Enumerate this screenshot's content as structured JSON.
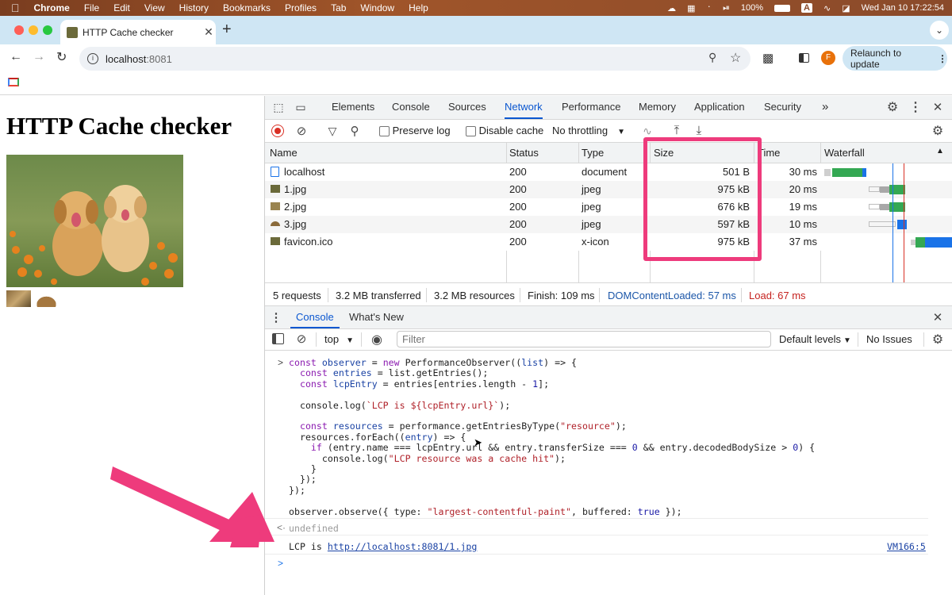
{
  "menubar": {
    "apple": "",
    "items": [
      "Chrome",
      "File",
      "Edit",
      "View",
      "History",
      "Bookmarks",
      "Profiles",
      "Tab",
      "Window",
      "Help"
    ],
    "battery": "100%",
    "input_source": "A",
    "datetime": "Wed Jan 10  17:22:54"
  },
  "browser": {
    "tab_title": "HTTP Cache checker",
    "new_tab": "+",
    "url_host": "localhost",
    "url_port": ":8081",
    "relaunch_label": "Relaunch to update",
    "profile_initial": "F"
  },
  "page": {
    "heading": "HTTP Cache checker"
  },
  "devtools": {
    "tabs": [
      "Elements",
      "Console",
      "Sources",
      "Network",
      "Performance",
      "Memory",
      "Application",
      "Security"
    ],
    "active_tab": "Network",
    "network_toolbar": {
      "preserve_log": "Preserve log",
      "disable_cache": "Disable cache",
      "throttling": "No throttling"
    },
    "columns": [
      "Name",
      "Status",
      "Type",
      "Size",
      "Time",
      "Waterfall"
    ],
    "rows": [
      {
        "name": "localhost",
        "status": "200",
        "type": "document",
        "size": "501 B",
        "time": "30 ms"
      },
      {
        "name": "1.jpg",
        "status": "200",
        "type": "jpeg",
        "size": "975 kB",
        "time": "20 ms"
      },
      {
        "name": "2.jpg",
        "status": "200",
        "type": "jpeg",
        "size": "676 kB",
        "time": "19 ms"
      },
      {
        "name": "3.jpg",
        "status": "200",
        "type": "jpeg",
        "size": "597 kB",
        "time": "10 ms"
      },
      {
        "name": "favicon.ico",
        "status": "200",
        "type": "x-icon",
        "size": "975 kB",
        "time": "37 ms"
      }
    ],
    "summary": {
      "requests": "5 requests",
      "transferred": "3.2 MB transferred",
      "resources": "3.2 MB resources",
      "finish": "Finish: 109 ms",
      "dcl": "DOMContentLoaded: 57 ms",
      "load": "Load: 67 ms"
    },
    "drawer_tabs": [
      "Console",
      "What's New"
    ],
    "console_toolbar": {
      "context": "top",
      "filter_placeholder": "Filter",
      "levels": "Default levels",
      "issues": "No Issues"
    },
    "console": {
      "result": "undefined",
      "log_prefix": "LCP is ",
      "log_link": "http://localhost:8081/1.jpg",
      "source_link": "VM166:5"
    }
  },
  "colors": {
    "highlight": "#ee3b7c",
    "accent": "#0b57d0"
  }
}
